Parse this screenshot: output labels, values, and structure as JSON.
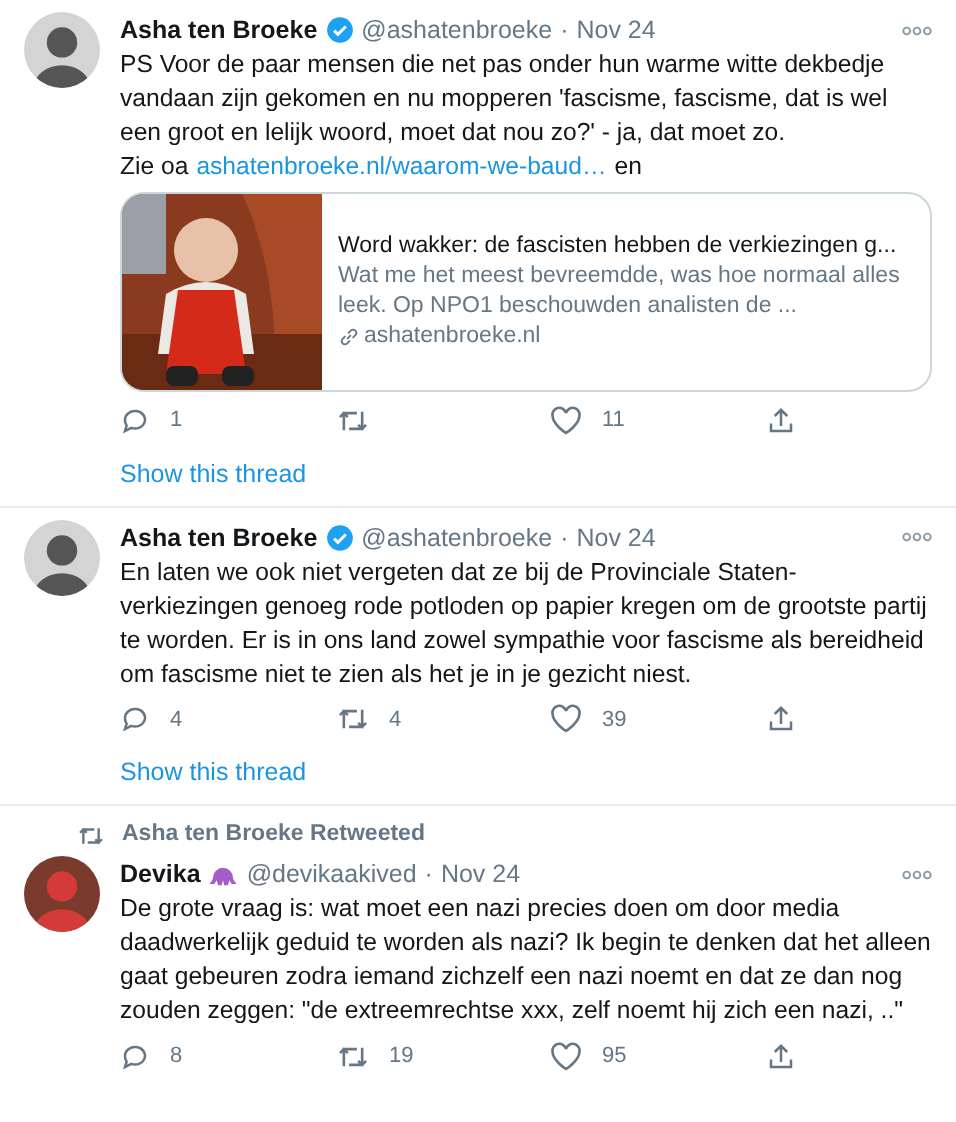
{
  "tweets": [
    {
      "name": "Asha ten Broeke",
      "verified": true,
      "handle": "@ashatenbroeke",
      "separator": "·",
      "date": "Nov 24",
      "text": "PS Voor de paar mensen die net pas onder hun warme witte dekbedje vandaan zijn gekomen en nu mopperen 'fascisme, fascisme, dat is wel een groot en lelijk woord, moet dat nou zo?' - ja, dat moet zo.",
      "link_line": {
        "before": "Zie oa",
        "link": "ashatenbroeke.nl/waarom-we-baud…",
        "after": "en"
      },
      "card": {
        "kind": "picture",
        "title": "Word wakker: de fascisten hebben de verkiezingen g...",
        "description": "Wat me het meest bevreemdde, was hoe normaal alles leek. Op NPO1 beschouwden analisten de ...",
        "domain": "ashatenbroeke.nl"
      },
      "replies": "1",
      "likes": "11",
      "show_thread": "Show this thread"
    },
    {
      "name": "Asha ten Broeke",
      "verified": true,
      "handle": "@ashatenbroeke",
      "separator": "·",
      "date": "Nov 24",
      "text": "En laten we ook niet vergeten dat ze bij de Provinciale Staten-verkiezingen genoeg rode potloden op papier kregen om de grootste partij te worden. Er is in ons land zowel sympathie voor fascisme als bereidheid om fascisme niet te zien als het je in je gezicht niest.",
      "replies": "4",
      "retweets": "4",
      "likes": "39",
      "show_thread": "Show this thread"
    },
    {
      "retweeted_by": "Asha ten Broeke Retweeted",
      "name": "Devika",
      "emoji": true,
      "handle": "@devikaakived",
      "separator": "·",
      "date": "Nov 24",
      "text": "De grote vraag is: wat moet een nazi precies doen om door media daadwerkelijk geduid te worden als nazi? Ik begin te denken dat het alleen gaat gebeuren zodra iemand zichzelf een nazi noemt en dat ze dan nog zouden zeggen: \"de extreemrechtse xxx, zelf noemt hij zich een nazi, ..\"",
      "replies": "8",
      "retweets": "19",
      "likes": "95"
    }
  ]
}
